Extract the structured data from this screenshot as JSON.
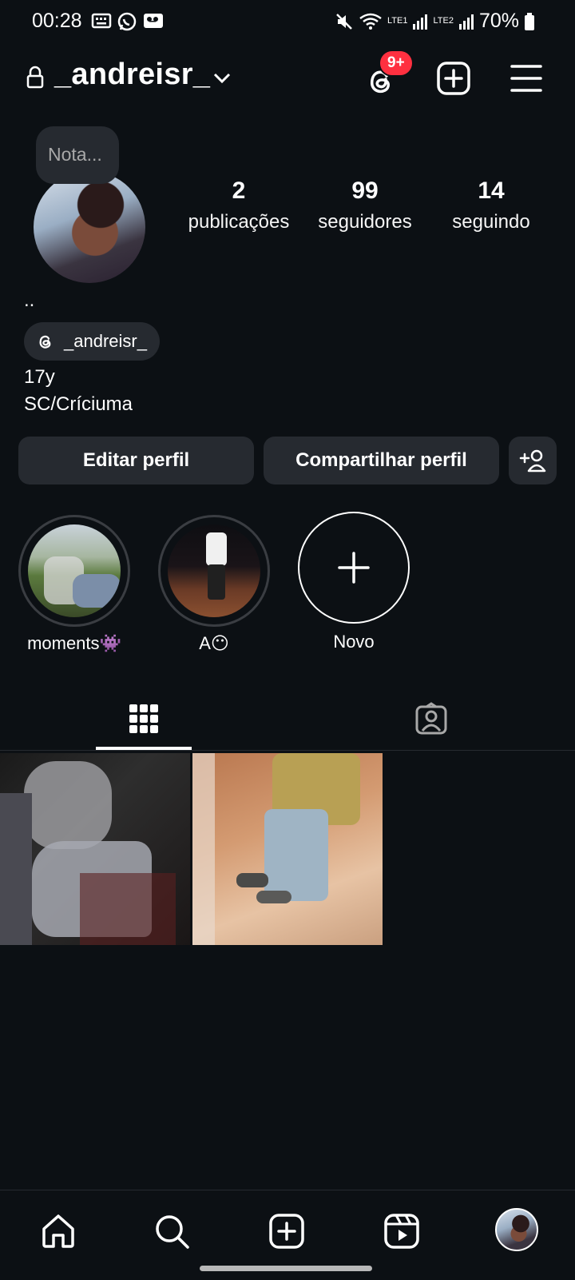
{
  "status_bar": {
    "time": "00:28",
    "signal1_label": "LTE1",
    "signal2_label": "LTE2",
    "battery": "70%"
  },
  "header": {
    "username": "_andreisr_",
    "threads_badge": "9+"
  },
  "profile": {
    "note": "Nota...",
    "stats": [
      {
        "value": "2",
        "label": "publicações"
      },
      {
        "value": "99",
        "label": "seguidores"
      },
      {
        "value": "14",
        "label": "seguindo"
      }
    ],
    "bio_name": "..",
    "threads_handle": "_andreisr_",
    "bio_lines": [
      "17y",
      "SC/Críciuma"
    ]
  },
  "actions": {
    "edit_label": "Editar perfil",
    "share_label": "Compartilhar perfil"
  },
  "highlights": [
    {
      "label": "moments👾"
    },
    {
      "label": "A😶"
    },
    {
      "label": "Novo"
    }
  ],
  "tabs": [
    {
      "icon": "grid-icon",
      "active": true
    },
    {
      "icon": "tagged-icon",
      "active": false
    }
  ],
  "bottom_nav": [
    {
      "icon": "home-icon"
    },
    {
      "icon": "search-icon"
    },
    {
      "icon": "create-icon"
    },
    {
      "icon": "reels-icon"
    },
    {
      "icon": "profile-avatar-icon"
    }
  ],
  "colors": {
    "background": "#0c1014",
    "surface": "#262a30",
    "badge": "#ff3040"
  }
}
